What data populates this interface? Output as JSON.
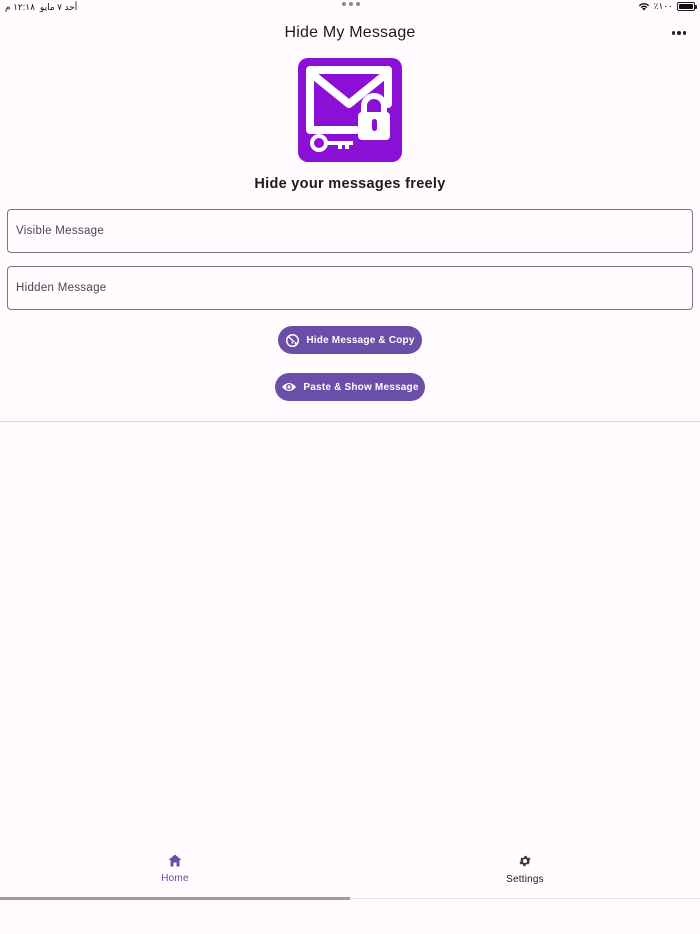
{
  "status_bar": {
    "time": "١٢:١٨ م",
    "date": "أحد ٧ مايو",
    "battery": "٪١٠٠"
  },
  "app_bar": {
    "title": "Hide My Message",
    "more_icon": "more-horizontal-icon"
  },
  "logo": {
    "icon": "envelope-lock-key-icon",
    "color": "#8a10d6"
  },
  "headline": "Hide your messages freely",
  "fields": {
    "visible_placeholder": "Visible Message",
    "hidden_placeholder": "Hidden Message"
  },
  "actions": {
    "hide_label": "Hide Message & Copy",
    "hide_icon": "eye-off-icon",
    "show_label": "Paste & Show Message",
    "show_icon": "eye-icon",
    "button_color": "#6a4ea8"
  },
  "bottom_nav": {
    "items": [
      {
        "label": "Home",
        "icon": "home-icon",
        "selected": true
      },
      {
        "label": "Settings",
        "icon": "gear-icon",
        "selected": false
      }
    ]
  }
}
